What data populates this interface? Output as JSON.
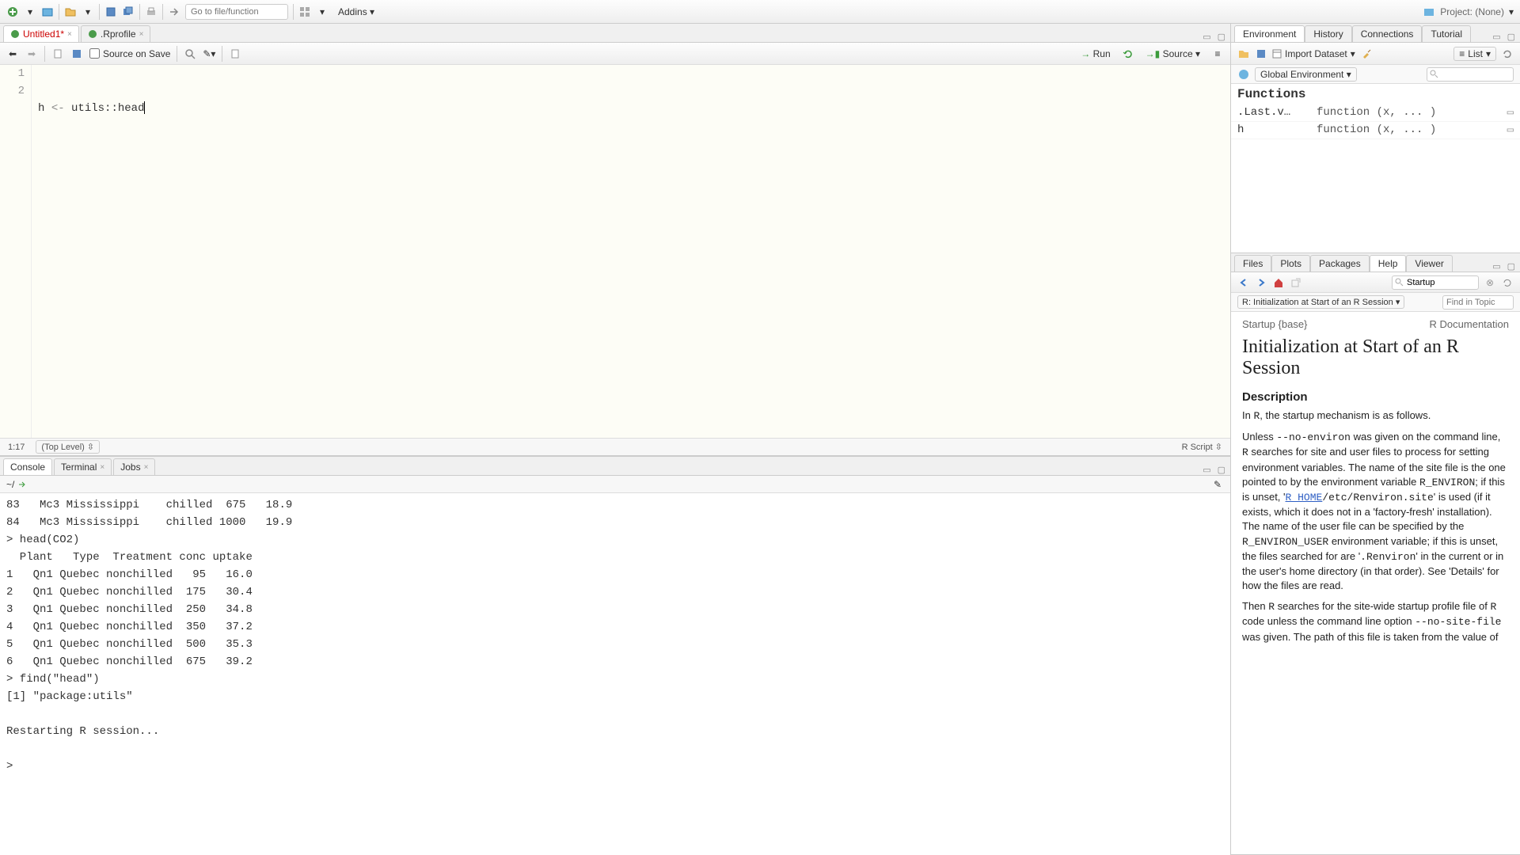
{
  "toolbar": {
    "goto_placeholder": "Go to file/function",
    "addins_label": "Addins",
    "project_label": "Project: (None)"
  },
  "source": {
    "tabs": [
      {
        "label": "Untitled1*",
        "unsaved": true
      },
      {
        "label": ".Rprofile",
        "unsaved": false
      }
    ],
    "source_on_save": "Source on Save",
    "run_label": "Run",
    "source_label": "Source",
    "lines": [
      {
        "n": "1",
        "text": "h <- utils::head"
      },
      {
        "n": "2",
        "text": ""
      }
    ],
    "cursor_pos": "1:17",
    "scope": "(Top Level)",
    "filetype": "R Script"
  },
  "console": {
    "tabs": [
      "Console",
      "Terminal",
      "Jobs"
    ],
    "wd": "~/",
    "output": "83   Mc3 Mississippi    chilled  675   18.9\n84   Mc3 Mississippi    chilled 1000   19.9\n> head(CO2)\n  Plant   Type  Treatment conc uptake\n1   Qn1 Quebec nonchilled   95   16.0\n2   Qn1 Quebec nonchilled  175   30.4\n3   Qn1 Quebec nonchilled  250   34.8\n4   Qn1 Quebec nonchilled  350   37.2\n5   Qn1 Quebec nonchilled  500   35.3\n6   Qn1 Quebec nonchilled  675   39.2\n> find(\"head\")\n[1] \"package:utils\"\n\nRestarting R session...\n\n> "
  },
  "env": {
    "tabs": [
      "Environment",
      "History",
      "Connections",
      "Tutorial"
    ],
    "import_label": "Import Dataset",
    "list_label": "List",
    "scope_label": "Global Environment",
    "heading": "Functions",
    "rows": [
      {
        "name": ".Last.v…",
        "value": "function (x, ..."
      },
      {
        "name": "h",
        "value": "function (x, ..."
      }
    ]
  },
  "help": {
    "tabs": [
      "Files",
      "Plots",
      "Packages",
      "Help",
      "Viewer"
    ],
    "search_value": "Startup",
    "topic_label": "R: Initialization at Start of an R Session",
    "find_placeholder": "Find in Topic",
    "page_left": "Startup {base}",
    "page_right": "R Documentation",
    "title": "Initialization at Start of an R Session",
    "section1": "Description",
    "p1_a": "In ",
    "p1_code": "R",
    "p1_b": ", the startup mechanism is as follows.",
    "p2_a": "Unless ",
    "p2_code1": "--no-environ",
    "p2_b": " was given on the command line, ",
    "p2_code2": "R",
    "p2_c": " searches for site and user files to process for setting environment variables. The name of the site file is the one pointed to by the environment variable ",
    "p2_code3": "R_ENVIRON",
    "p2_d": "; if this is unset, '",
    "p2_link": "R_HOME",
    "p2_code4": "/etc/Renviron.site",
    "p2_e": "' is used (if it exists, which it does not in a 'factory-fresh' installation). The name of the user file can be specified by the ",
    "p2_code5": "R_ENVIRON_USER",
    "p2_f": " environment variable; if this is unset, the files searched for are '",
    "p2_code6": ".Renviron",
    "p2_g": "' in the current or in the user's home directory (in that order). See 'Details' for how the files are read.",
    "p3_a": "Then ",
    "p3_code1": "R",
    "p3_b": " searches for the site-wide startup profile file of ",
    "p3_code2": "R",
    "p3_c": " code unless the command line option ",
    "p3_code3": "--no-site-file",
    "p3_d": " was given. The path of this file is taken from the value of"
  }
}
